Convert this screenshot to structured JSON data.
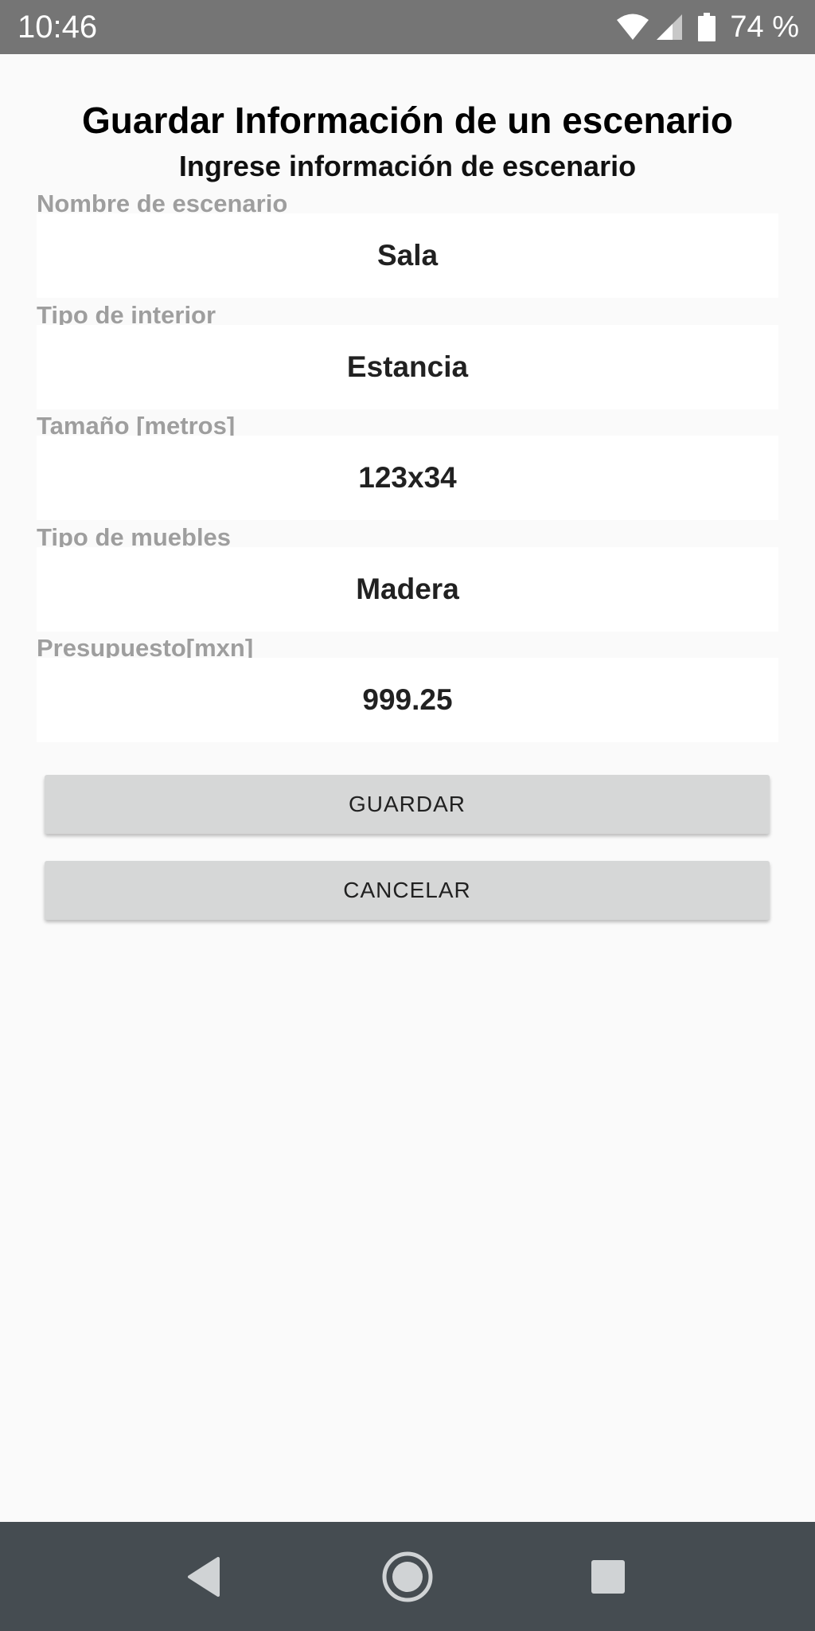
{
  "status_bar": {
    "time": "10:46",
    "battery": "74 %",
    "icons": [
      "wifi-icon",
      "signal-icon",
      "battery-icon"
    ]
  },
  "page": {
    "title": "Guardar Información de un escenario",
    "subtitle": "Ingrese información de escenario"
  },
  "fields": [
    {
      "label": "Nombre de escenario",
      "value": "Sala"
    },
    {
      "label": "Tipo de interior",
      "value": "Estancia"
    },
    {
      "label": "Tamaño [metros]",
      "value": "123x34"
    },
    {
      "label": "Tipo de muebles",
      "value": "Madera"
    },
    {
      "label": "Presupuesto[mxn]",
      "value": "999.25"
    }
  ],
  "buttons": {
    "save": "GUARDAR",
    "cancel": "CANCELAR"
  },
  "nav": {
    "icons": [
      "back-icon",
      "home-icon",
      "recents-icon"
    ]
  },
  "colors": {
    "status_bar": "#757575",
    "nav_bar": "#454c51",
    "background": "#fafafa",
    "button": "#d6d7d7",
    "label": "#9e9e9e"
  }
}
